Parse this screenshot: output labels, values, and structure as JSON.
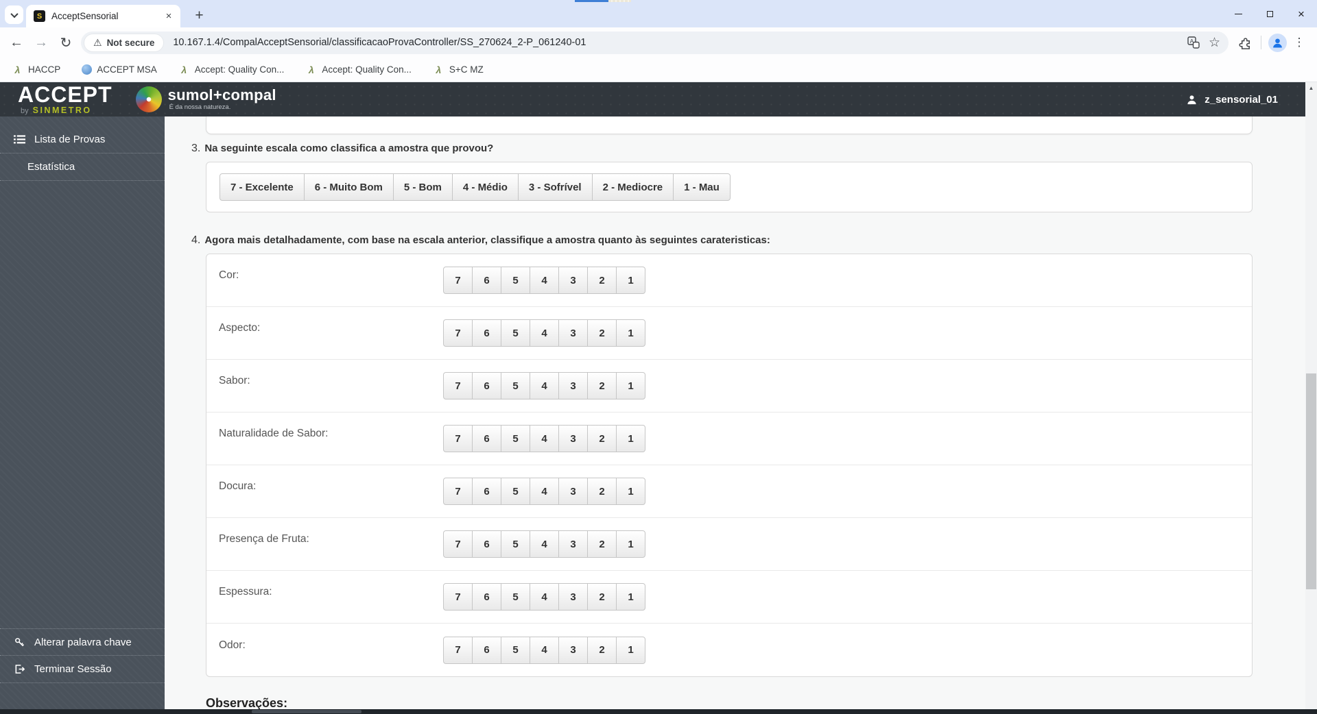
{
  "browser": {
    "tab_title": "AcceptSensorial",
    "favicon_letter": "S",
    "url": "10.167.1.4/CompalAcceptSensorial/classificacaoProvaController/SS_270624_2-P_061240-01",
    "security_label": "Not secure",
    "bookmarks": [
      {
        "label": "HACCP",
        "icon": "lambda-icon"
      },
      {
        "label": "ACCEPT MSA",
        "icon": "globe-icon"
      },
      {
        "label": "Accept: Quality Con...",
        "icon": "lambda-icon"
      },
      {
        "label": "Accept: Quality Con...",
        "icon": "lambda-icon"
      },
      {
        "label": "S+C MZ",
        "icon": "lambda-icon"
      }
    ]
  },
  "site": {
    "header": {
      "app_name": "ACCEPT",
      "app_by": "by",
      "app_vendor": "SINMETRO",
      "brand": "sumol+compal",
      "brand_tagline": "É da nossa natureza.",
      "username": "z_sensorial_01"
    },
    "sidebar": {
      "items": [
        {
          "label": "Lista de Provas"
        },
        {
          "label": "Estatística"
        }
      ],
      "footer": [
        {
          "label": "Alterar palavra chave"
        },
        {
          "label": "Terminar Sessão"
        }
      ]
    },
    "form": {
      "q3_number": "3.",
      "q3_text": "Na seguinte escala como classifica a amostra que provou?",
      "q3_options": [
        "7 - Excelente",
        "6 - Muito Bom",
        "5 - Bom",
        "4 - Médio",
        "3 - Sofrível",
        "2 - Mediocre",
        "1 - Mau"
      ],
      "q4_number": "4.",
      "q4_text": "Agora mais detalhadamente, com base na escala anterior, classifique a amostra quanto às seguintes carateristicas:",
      "q4_scale": [
        "7",
        "6",
        "5",
        "4",
        "3",
        "2",
        "1"
      ],
      "q4_rows": [
        "Cor:",
        "Aspecto:",
        "Sabor:",
        "Naturalidade de Sabor:",
        "Docura:",
        "Presença de Fruta:",
        "Espessura:",
        "Odor:"
      ],
      "observations_label": "Observações:"
    },
    "theme": {
      "header_bg": "#31373d",
      "sidebar_bg": "#4a525b",
      "vendor_green": "#b5c026",
      "avatar_blue": "#1a73e8",
      "tabstrip_blue": "#dbe5f9"
    }
  }
}
